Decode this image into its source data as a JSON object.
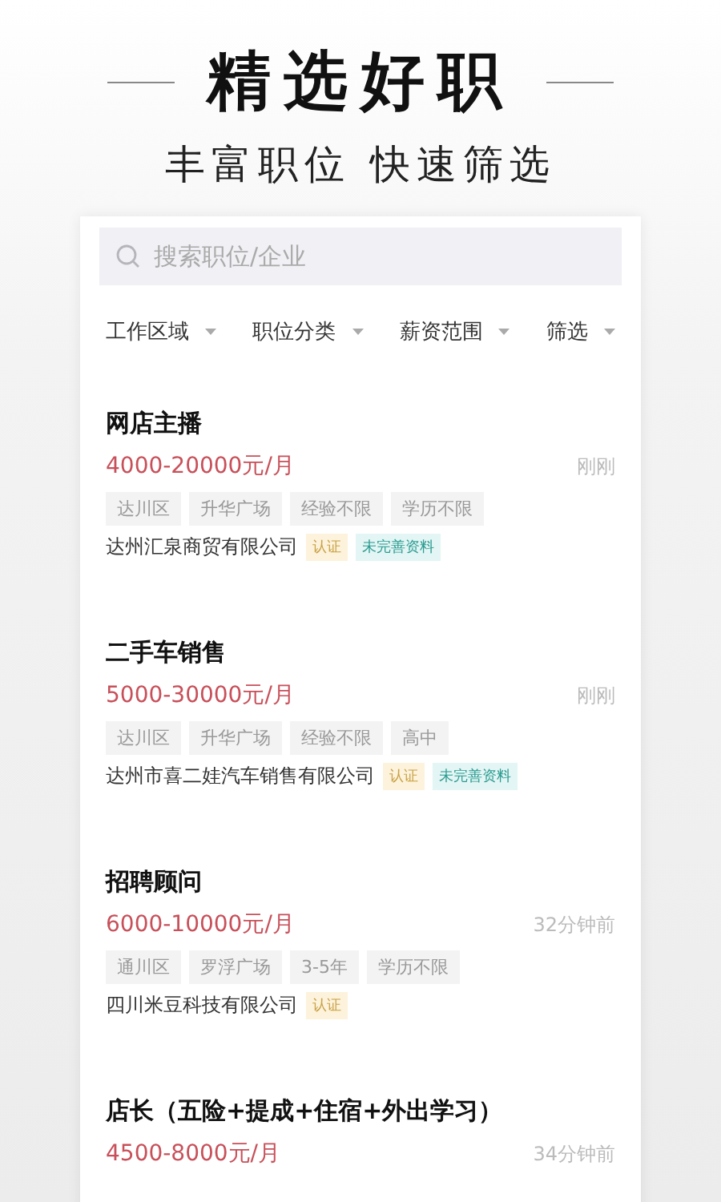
{
  "headline": "精选好职",
  "subtitle": "丰富职位 快速筛选",
  "search": {
    "placeholder": "搜索职位/企业"
  },
  "filters": [
    "工作区域",
    "职位分类",
    "薪资范围",
    "筛选"
  ],
  "jobs": [
    {
      "title": "网店主播",
      "salary": "4000-20000元/月",
      "time": "刚刚",
      "tags": [
        "达川区",
        "升华广场",
        "经验不限",
        "学历不限"
      ],
      "company": "达州汇泉商贸有限公司",
      "badges": [
        {
          "kind": "verified",
          "text": "认证"
        },
        {
          "kind": "incomplete",
          "text": "未完善资料"
        }
      ]
    },
    {
      "title": "二手车销售",
      "salary": "5000-30000元/月",
      "time": "刚刚",
      "tags": [
        "达川区",
        "升华广场",
        "经验不限",
        "高中"
      ],
      "company": "达州市喜二娃汽车销售有限公司",
      "badges": [
        {
          "kind": "verified",
          "text": "认证"
        },
        {
          "kind": "incomplete",
          "text": "未完善资料"
        }
      ]
    },
    {
      "title": "招聘顾问",
      "salary": "6000-10000元/月",
      "time": "32分钟前",
      "tags": [
        "通川区",
        "罗浮广场",
        "3-5年",
        "学历不限"
      ],
      "company": "四川米豆科技有限公司",
      "badges": [
        {
          "kind": "verified",
          "text": "认证"
        }
      ]
    },
    {
      "title": "店长（五险+提成+住宿+外出学习）",
      "salary": "4500-8000元/月",
      "time": "34分钟前"
    }
  ]
}
